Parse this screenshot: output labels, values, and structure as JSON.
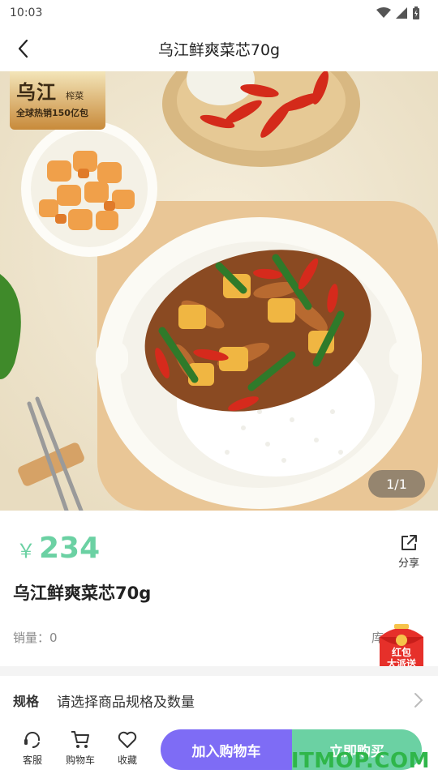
{
  "status_bar": {
    "time": "10:03"
  },
  "header": {
    "title": "乌江鲜爽菜芯70g"
  },
  "hero": {
    "brand_name": "乌江",
    "brand_sub": "榨菜",
    "brand_slogan": "全球热销150亿包",
    "page_indicator": "1/1"
  },
  "product": {
    "price_symbol": "￥",
    "price": "234",
    "share_label": "分享",
    "title": "乌江鲜爽菜芯70g",
    "sales_text": "销量：0",
    "stock_text": "库存：6"
  },
  "red_packet": {
    "line1": "红包",
    "line2": "大派送"
  },
  "spec": {
    "label": "规格",
    "value": "请选择商品规格及数量"
  },
  "bottom_bar": {
    "service_label": "客服",
    "cart_label": "购物车",
    "favorite_label": "收藏",
    "add_to_cart": "加入购物车",
    "buy_now": "立即购买"
  },
  "watermark": "ITMOP.COM",
  "colors": {
    "price": "#6bd1a3",
    "cart_button": "#7e6cf5",
    "buy_button": "#6bd1a3"
  }
}
